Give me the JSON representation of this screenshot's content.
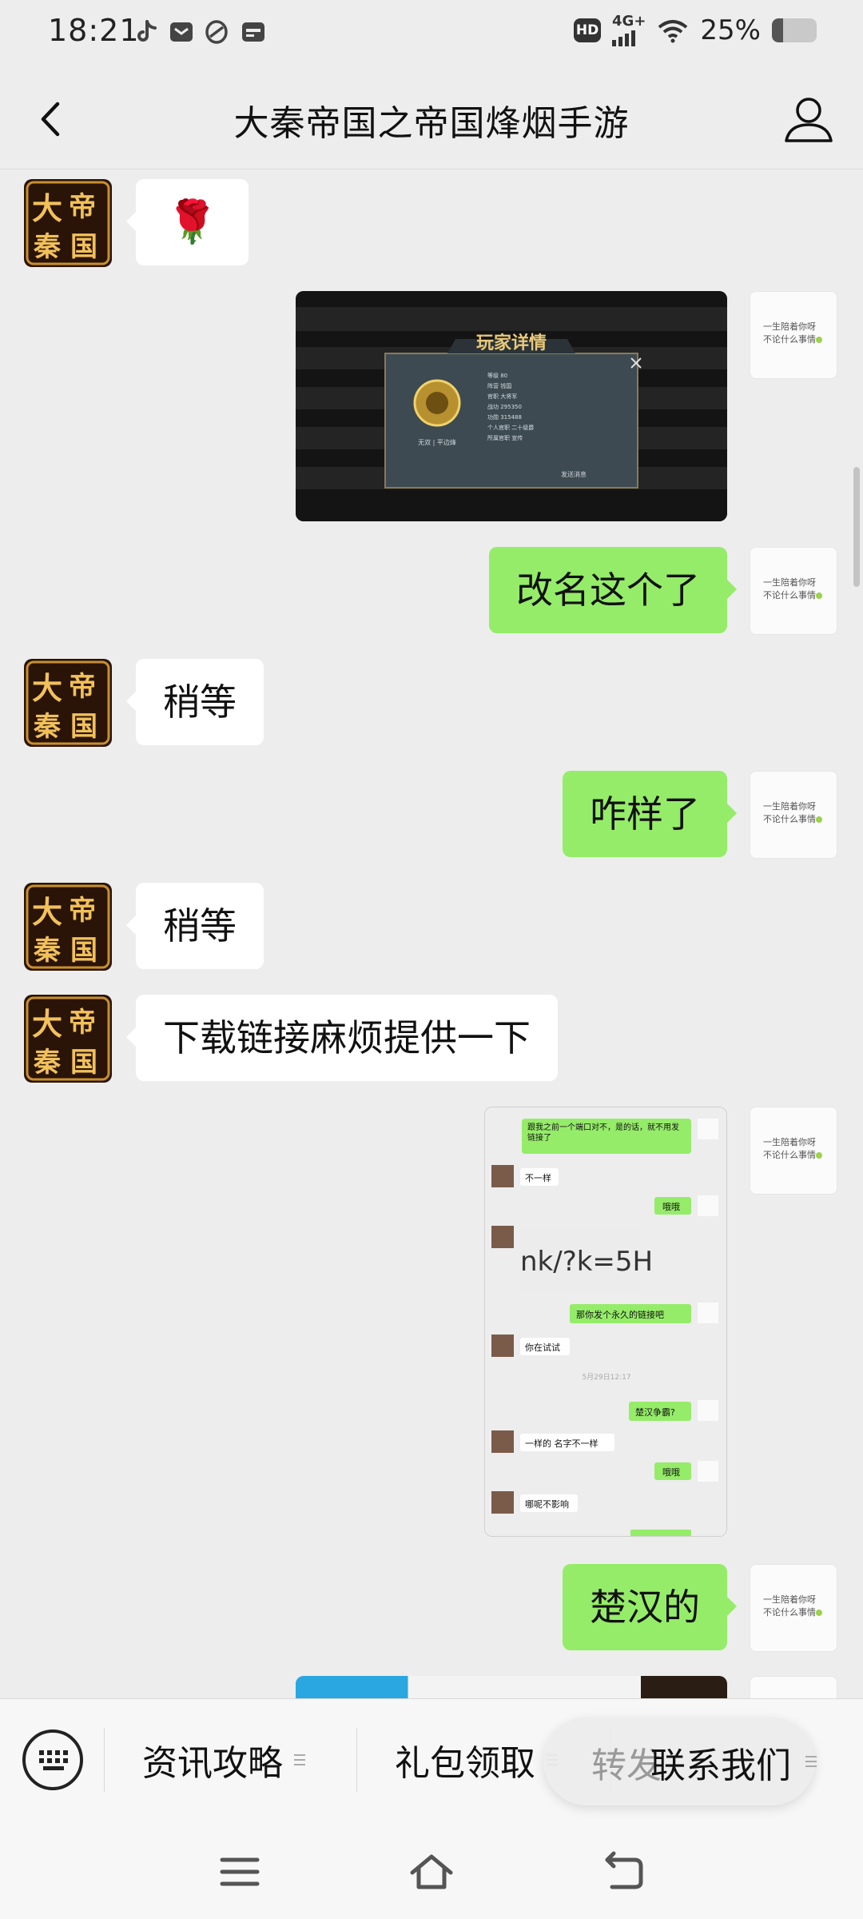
{
  "status_bar": {
    "time": "18:21",
    "hd_label": "HD",
    "network_label": "4G+",
    "battery_percent": "25%",
    "battery_level": 0.25,
    "left_icons": [
      "tiktok-icon",
      "mail-icon",
      "app-icon",
      "wallet-icon"
    ]
  },
  "nav": {
    "title": "大秦帝国之帝国烽烟手游",
    "back_icon": "chevron-left-icon",
    "profile_icon": "person-icon"
  },
  "messages": [
    {
      "side": "left",
      "type": "emoji",
      "content": "🌹"
    },
    {
      "side": "right",
      "type": "image",
      "content": "玩家详情"
    },
    {
      "side": "right",
      "type": "text",
      "content": "改名这个了"
    },
    {
      "side": "left",
      "type": "text",
      "content": "稍等"
    },
    {
      "side": "right",
      "type": "text",
      "content": "咋样了"
    },
    {
      "side": "left",
      "type": "text",
      "content": "稍等"
    },
    {
      "side": "left",
      "type": "text",
      "content": "下载链接麻烦提供一下"
    },
    {
      "side": "right",
      "type": "image",
      "content": "screenshot"
    },
    {
      "side": "right",
      "type": "text",
      "content": "楚汉的"
    }
  ],
  "avatar_left_chars": [
    "大",
    "帝",
    "秦",
    "国"
  ],
  "avatar_right_text": [
    "一生陪着你呀",
    "不论什么事情"
  ],
  "game_image": {
    "title": "玩家详情",
    "rows": [
      "等级 80",
      "阵营 钱国",
      "官职 大将军",
      "战功 295350",
      "功勋 315488",
      "个人官职 二十级爵",
      "所属官职 宣传"
    ],
    "left_caption": "无双 | 平边烽",
    "bottom_caption": "发送消息"
  },
  "chat_screenshot": {
    "items": [
      {
        "side": "right",
        "text": "跟我之前一个端口对不，是的话，就不用发链接了"
      },
      {
        "side": "left",
        "text": "不一样"
      },
      {
        "side": "right",
        "text": "哦哦"
      },
      {
        "side": "left",
        "text": "nk/?k=5H"
      },
      {
        "side": "right",
        "text": "那你发个永久的链接吧"
      },
      {
        "side": "left",
        "text": "你在试试"
      },
      {
        "side": "center",
        "text": "5月29日12:17"
      },
      {
        "side": "right",
        "text": "楚汉争霸?"
      },
      {
        "side": "left",
        "text": "一样的 名字不一样"
      },
      {
        "side": "right",
        "text": "哦哦"
      },
      {
        "side": "left",
        "text": "哪呢不影响"
      }
    ]
  },
  "menu": {
    "keyboard_icon": "keyboard-icon",
    "items": [
      "资讯攻略",
      "礼包领取",
      "联系我们"
    ],
    "forward_label": "转发"
  },
  "system_nav": {
    "menu_icon": "menu-icon",
    "home_icon": "home-icon",
    "back_icon": "back-icon"
  },
  "colors": {
    "background": "#ededed",
    "bubble_self": "#95ec69",
    "bubble_other": "#ffffff"
  }
}
